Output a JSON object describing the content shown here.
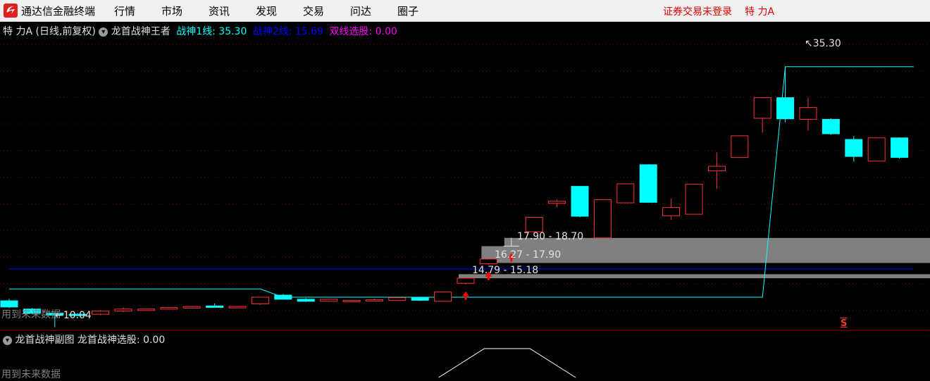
{
  "app": {
    "title": "通达信金融终端"
  },
  "menu": {
    "items": [
      "行情",
      "市场",
      "资讯",
      "发现",
      "交易",
      "问达",
      "圈子"
    ]
  },
  "header_right": {
    "login_status": "证券交易未登录",
    "stock_name": "特 力A"
  },
  "main_panel": {
    "security": "特 力A",
    "period": "(日线,前复权)",
    "indicator_name": "龙首战神王者",
    "line1_label": "战神1线: 35.30",
    "line2_label": "战神2线: 15.69",
    "select_label": "双线选股: 0.00",
    "future_data_note": "用到未来数据",
    "low_marker": "10.04",
    "high_marker": "35.30",
    "zones": [
      "17.90 - 18.70",
      "16.27 - 17.90",
      "14.79 - 15.18"
    ],
    "signal_marker": "S"
  },
  "sub_panel": {
    "indicator_name": "龙首战神副图",
    "select_label": "龙首战神选股: 0.00",
    "future_data_note": "用到未来数据"
  },
  "colors": {
    "up": "#ff3232",
    "down": "#00ffff",
    "line1": "#00ffff",
    "line2": "#0000ff",
    "select": "#ff00ff",
    "zone": "#808080",
    "grid": "#8b0000"
  },
  "chart_data": {
    "type": "candlestick",
    "y_unit": "price",
    "series": [
      {
        "open": 12.6,
        "close": 12.0,
        "high": 12.8,
        "low": 11.9
      },
      {
        "open": 11.8,
        "close": 11.4,
        "high": 11.9,
        "low": 11.3
      },
      {
        "open": 11.4,
        "close": 11.2,
        "high": 11.5,
        "low": 10.04
      },
      {
        "open": 11.3,
        "close": 11.2,
        "high": 11.4,
        "low": 11.1
      },
      {
        "open": 11.3,
        "close": 11.6,
        "high": 11.7,
        "low": 11.2
      },
      {
        "open": 11.6,
        "close": 11.8,
        "high": 11.95,
        "low": 11.5
      },
      {
        "open": 11.75,
        "close": 11.8,
        "high": 11.85,
        "low": 11.7
      },
      {
        "open": 11.8,
        "close": 11.95,
        "high": 12.0,
        "low": 11.75
      },
      {
        "open": 11.9,
        "close": 12.05,
        "high": 12.1,
        "low": 11.85
      },
      {
        "open": 12.1,
        "close": 12.05,
        "high": 12.35,
        "low": 12.0
      },
      {
        "open": 11.95,
        "close": 12.05,
        "high": 12.1,
        "low": 11.9
      },
      {
        "open": 12.3,
        "close": 12.95,
        "high": 13.0,
        "low": 12.2
      },
      {
        "open": 13.15,
        "close": 12.75,
        "high": 13.25,
        "low": 12.7
      },
      {
        "open": 12.75,
        "close": 12.55,
        "high": 12.85,
        "low": 12.5
      },
      {
        "open": 12.55,
        "close": 12.75,
        "high": 12.8,
        "low": 12.5
      },
      {
        "open": 12.6,
        "close": 12.65,
        "high": 12.7,
        "low": 12.55
      },
      {
        "open": 12.6,
        "close": 12.7,
        "high": 12.8,
        "low": 12.55
      },
      {
        "open": 12.65,
        "close": 12.9,
        "high": 12.95,
        "low": 12.6
      },
      {
        "open": 12.9,
        "close": 12.65,
        "high": 13.0,
        "low": 12.6
      },
      {
        "open": 12.55,
        "close": 13.45,
        "high": 13.5,
        "low": 12.5
      },
      {
        "open": 14.3,
        "close": 14.8,
        "high": 15.0,
        "low": 14.2
      },
      {
        "open": 16.2,
        "close": 16.65,
        "high": 16.7,
        "low": 16.1
      },
      {
        "open": 17.9,
        "close": 17.9,
        "high": 18.7,
        "low": 17.9
      },
      {
        "open": 19.3,
        "close": 20.7,
        "high": 20.75,
        "low": 19.25
      },
      {
        "open": 22.05,
        "close": 22.25,
        "high": 22.4,
        "low": 21.7
      },
      {
        "open": 23.7,
        "close": 20.8,
        "high": 23.7,
        "low": 20.7
      },
      {
        "open": 18.7,
        "close": 22.4,
        "high": 22.45,
        "low": 18.7
      },
      {
        "open": 22.1,
        "close": 23.95,
        "high": 24.0,
        "low": 22.05
      },
      {
        "open": 25.8,
        "close": 22.15,
        "high": 25.85,
        "low": 22.1
      },
      {
        "open": 20.85,
        "close": 21.65,
        "high": 22.5,
        "low": 20.45
      },
      {
        "open": 21.0,
        "close": 23.9,
        "high": 23.95,
        "low": 21.0
      },
      {
        "open": 25.2,
        "close": 25.65,
        "high": 27.0,
        "low": 23.45
      },
      {
        "open": 26.5,
        "close": 28.6,
        "high": 28.65,
        "low": 26.45
      },
      {
        "open": 30.3,
        "close": 32.3,
        "high": 32.35,
        "low": 28.9
      },
      {
        "open": 32.3,
        "close": 30.25,
        "high": 35.3,
        "low": 29.9
      },
      {
        "open": 30.2,
        "close": 31.35,
        "high": 32.3,
        "low": 29.1
      },
      {
        "open": 30.2,
        "close": 28.8,
        "high": 30.3,
        "low": 28.7
      },
      {
        "open": 28.25,
        "close": 26.6,
        "high": 28.6,
        "low": 26.1
      },
      {
        "open": 26.15,
        "close": 28.4,
        "high": 28.45,
        "low": 26.1
      },
      {
        "open": 28.4,
        "close": 26.5,
        "high": 28.45,
        "low": 26.4
      }
    ],
    "line1": [
      13.75,
      13.75,
      13.75,
      13.75,
      13.75,
      13.75,
      13.75,
      13.75,
      13.75,
      13.75,
      13.75,
      13.75,
      12.95,
      12.95,
      12.95,
      12.95,
      12.95,
      12.95,
      12.95,
      12.95,
      12.95,
      12.95,
      12.95,
      12.95,
      12.95,
      12.95,
      12.95,
      12.95,
      12.95,
      12.95,
      12.95,
      12.95,
      12.95,
      12.95,
      35.3,
      35.3,
      35.3,
      35.3,
      35.3,
      35.3
    ],
    "line2": 15.69,
    "zones": [
      {
        "low": 17.9,
        "high": 18.7,
        "from_index": 22
      },
      {
        "low": 16.27,
        "high": 17.9,
        "from_index": 21
      },
      {
        "low": 14.79,
        "high": 15.18,
        "from_index": 20
      }
    ],
    "signals": [
      20,
      21,
      22
    ],
    "sub_series": [
      0,
      0,
      0,
      0,
      0,
      0,
      0,
      0,
      0,
      0,
      0,
      0,
      0,
      0,
      0,
      0,
      0,
      0,
      0,
      0,
      0.5,
      1,
      1,
      1,
      0.5,
      0,
      0,
      0,
      0,
      0,
      0,
      0,
      0,
      0,
      0,
      0,
      0,
      0,
      0,
      0
    ]
  }
}
